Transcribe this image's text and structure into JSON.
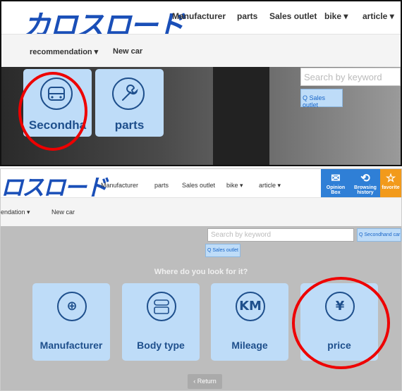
{
  "top": {
    "logo": "カロスロード",
    "nav": [
      "Manufacturer",
      "parts",
      "Sales outlet",
      "bike ▾",
      "article ▾"
    ],
    "subnav": [
      "recommendation ▾",
      "New car"
    ],
    "search_placeholder": "Search by keyword",
    "sales_button": "Q Sales outlet",
    "tiles": [
      {
        "label": "Secondha",
        "icon": "car-icon"
      },
      {
        "label": "parts",
        "icon": "wrench-icon"
      }
    ],
    "highlight_color": "#e00000"
  },
  "bottom": {
    "logo": "ロスロード",
    "nav": [
      "Manufacturer",
      "parts",
      "Sales outlet",
      "bike ▾",
      "article ▾"
    ],
    "squares": [
      {
        "label1": "Opinion",
        "label2": "Box",
        "icon": "mail-icon",
        "color": "#2f7fd6"
      },
      {
        "label1": "Browsing",
        "label2": "history",
        "icon": "history-icon",
        "color": "#2f7fd6"
      },
      {
        "label1": "favorite",
        "label2": "",
        "icon": "star-icon",
        "color": "#f29a1b"
      }
    ],
    "subnav": [
      "endation ▾",
      "New car"
    ],
    "search_placeholder": "Search by keyword",
    "secondhand_button": "Q Secondhand car",
    "sales_button": "Q Sales outlet",
    "prompt": "Where do you look for it?",
    "tiles": [
      {
        "label": "Manufacturer",
        "icon": "manufacturer-icon",
        "glyph": "⊕"
      },
      {
        "label": "Body type",
        "icon": "car-body-icon",
        "glyph": ""
      },
      {
        "label": "Mileage",
        "icon": "km-icon",
        "glyph": "KM"
      },
      {
        "label": "price",
        "icon": "yen-icon",
        "glyph": "¥"
      }
    ],
    "return_button": "‹ Return"
  },
  "colors": {
    "brand": "#1a4fb8",
    "tile": "#bedcf8",
    "tile_text": "#1e4f8c"
  }
}
